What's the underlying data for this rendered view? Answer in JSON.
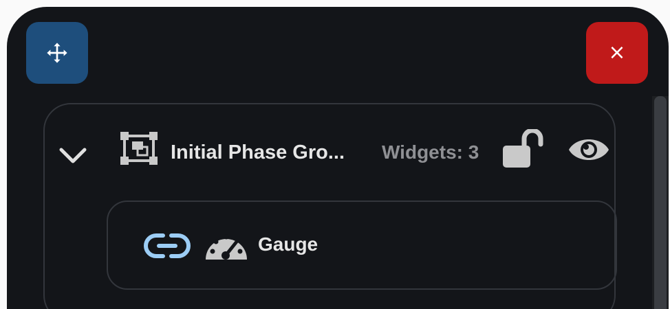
{
  "toolbar": {
    "move_icon": "move-arrows-icon",
    "close_label": "×"
  },
  "group": {
    "collapse_icon": "chevron-down-icon",
    "icon": "group-object-icon",
    "name": "Initial Phase Gro...",
    "widget_count": "Widgets: 3",
    "lock_icon": "unlocked-padlock-icon",
    "visibility_icon": "eye-icon",
    "widgets": [
      {
        "link_icon": "link-icon",
        "type_icon": "gauge-icon",
        "name": "Gauge"
      }
    ]
  },
  "colors": {
    "panel_bg": "#131519",
    "move_button": "#1e4e7c",
    "close_button": "#c01a1a",
    "link_accent": "#9ccdf5",
    "muted_text": "#8f9094",
    "text": "#e6e6e6",
    "border": "#33363c"
  }
}
